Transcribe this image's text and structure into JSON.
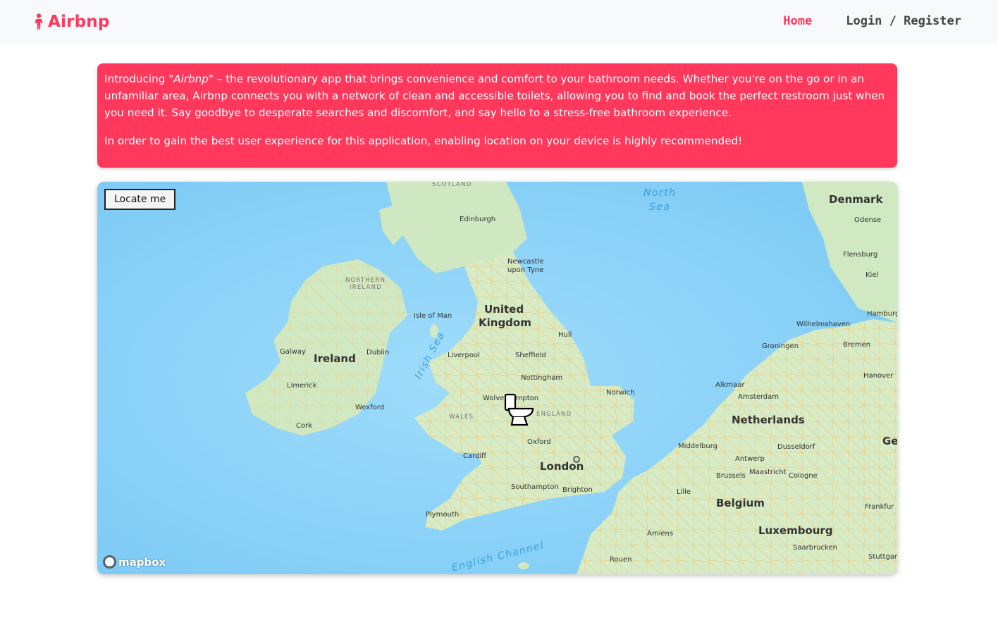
{
  "brand": {
    "name": "Airbnp",
    "icon": "person-icon",
    "color": "#ff385c"
  },
  "nav": {
    "home_label": "Home",
    "login_label": "Login / Register"
  },
  "intro": {
    "p1_before": "Introducing \"",
    "p1_app": "Airbnp",
    "p1_after": "\" – the revolutionary app that brings convenience and comfort to your bathroom needs. Whether you're on the go or in an unfamiliar area, Airbnp connects you with a network of clean and accessible toilets, allowing you to find and book the perfect restroom just when you need it. Say goodbye to desperate searches and discomfort, and say hello to a stress-free bathroom experience.",
    "p2": "In order to gain the best user experience for this application, enabling location on your device is highly recommended!",
    "background": "#ff385c"
  },
  "map": {
    "locate_label": "Locate me",
    "attribution": "mapbox",
    "marker_icon": "toilet-icon",
    "labels": {
      "scotland": "SCOTLAND",
      "edinburgh": "Edinburgh",
      "north_sea_1": "North",
      "north_sea_2": "Sea",
      "denmark": "Denmark",
      "odense": "Odense",
      "newcastle_1": "Newcastle",
      "newcastle_2": "upon Tyne",
      "flensburg": "Flensburg",
      "kiel": "Kiel",
      "northern_ireland_1": "NORTHERN",
      "northern_ireland_2": "IRELAND",
      "isle_of_man": "Isle of Man",
      "uk_1": "United",
      "uk_2": "Kingdom",
      "hamburg": "Hamburg",
      "wilhelmshaven": "Wilhelmshaven",
      "hull": "Hull",
      "groningen": "Groningen",
      "bremen": "Bremen",
      "galway": "Galway",
      "ireland": "Ireland",
      "dublin": "Dublin",
      "irish_sea": "Irish Sea",
      "liverpool": "Liverpool",
      "sheffield": "Sheffield",
      "nottingham": "Nottingham",
      "norwich": "Norwich",
      "alkmaar": "Alkmaar",
      "amsterdam": "Amsterdam",
      "hanover": "Hanover",
      "limerick": "Limerick",
      "wolverhampton": "Wolverhampton",
      "wexford": "Wexford",
      "wales": "WALES",
      "england": "ENGLAND",
      "netherlands": "Netherlands",
      "cork": "Cork",
      "oxford": "Oxford",
      "middelburg": "Middelburg",
      "dusseldorf": "Dusseldorf",
      "germany": "Germ",
      "cardiff": "Cardiff",
      "london": "London",
      "antwerp": "Antwerp",
      "brussels": "Brussels",
      "maastricht": "Maastricht",
      "cologne": "Cologne",
      "southampton": "Southampton",
      "brighton": "Brighton",
      "lille": "Lille",
      "belgium": "Belgium",
      "frankfurt": "Frankfur",
      "plymouth": "Plymouth",
      "amiens": "Amiens",
      "luxembourg": "Luxembourg",
      "english_channel": "English Channel",
      "saarbrucken": "Saarbrucken",
      "stuttgart": "Stuttgart",
      "rouen": "Rouen"
    }
  }
}
